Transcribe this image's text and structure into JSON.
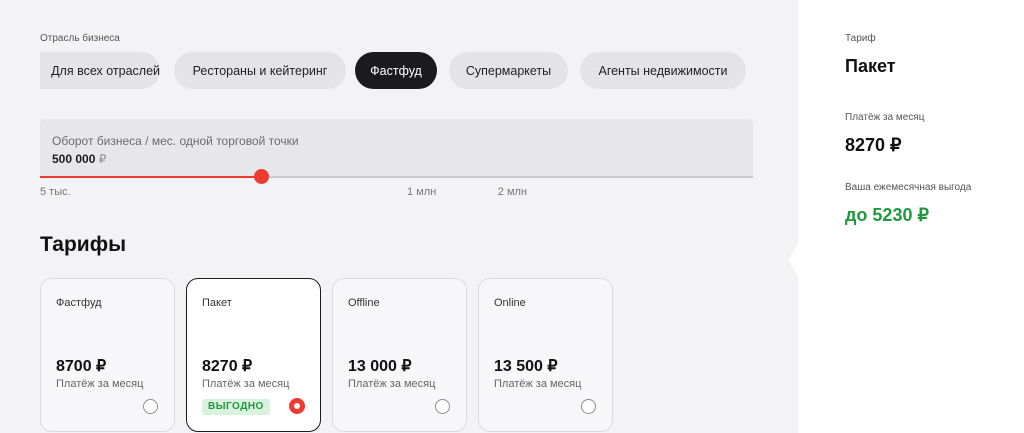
{
  "industry": {
    "label": "Отрасль бизнеса",
    "chips": [
      "Для всех отраслей",
      "Рестораны и кейтеринг",
      "Фастфуд",
      "Супермаркеты",
      "Агенты недвижимости"
    ],
    "selected": "Фастфуд"
  },
  "turnover": {
    "label": "Оборот бизнеса / мес. одной торговой точки",
    "value": "500 000",
    "currency": "₽",
    "slider_fraction": 0.31,
    "ticks": {
      "min": "5 тыс.",
      "mid": "1 млн",
      "max": "2 млн"
    }
  },
  "tariffs": {
    "title": "Тарифы",
    "cards": [
      {
        "name": "Фастфуд",
        "price": "8700 ₽",
        "period": "Платёж за месяц",
        "selected": false
      },
      {
        "name": "Пакет",
        "price": "8270 ₽",
        "period": "Платёж за месяц",
        "selected": true,
        "badge": "ВЫГОДНО"
      },
      {
        "name": "Offline",
        "price": "13 000 ₽",
        "period": "Платёж за месяц",
        "selected": false
      },
      {
        "name": "Online",
        "price": "13 500 ₽",
        "period": "Платёж за месяц",
        "selected": false
      }
    ]
  },
  "summary": {
    "tariff_label": "Тариф",
    "tariff_value": "Пакет",
    "payment_label": "Платёж за месяц",
    "payment_value": "8270 ₽",
    "benefit_label": "Ваша ежемесячная выгода",
    "benefit_value": "до 5230 ₽",
    "benefit_color": "#1e9a3c"
  },
  "colors": {
    "accent": "#ee3b32",
    "chip_active": "#1b1b1f",
    "badge_bg": "#d9f2dd"
  }
}
